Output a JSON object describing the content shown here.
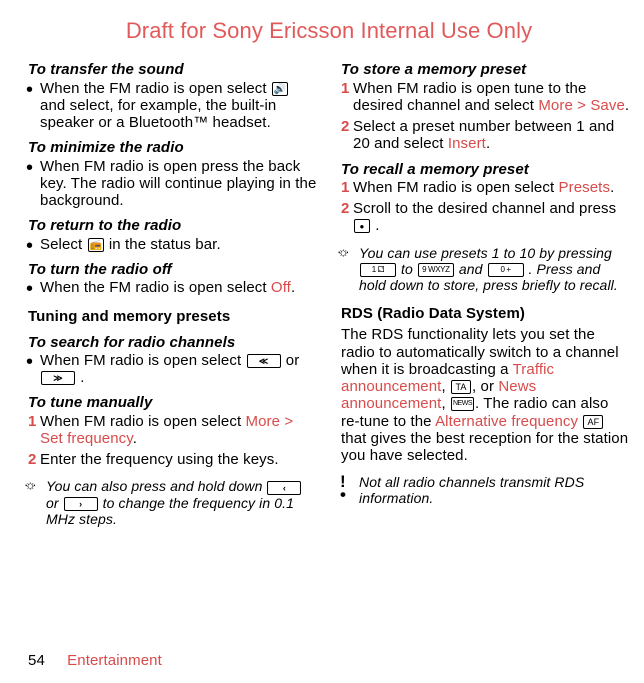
{
  "header": "Draft for Sony Ericsson Internal Use Only",
  "left": {
    "transfer": {
      "title": "To transfer the sound",
      "text_a": "When the FM radio is open select ",
      "text_b": " and select, for example, the built-in speaker or a Bluetooth™ headset."
    },
    "minimize": {
      "title": "To minimize the radio",
      "text": "When FM radio is open press the back key. The radio will continue playing in the background."
    },
    "return": {
      "title": "To return to the radio",
      "text_a": "Select ",
      "text_b": " in the status bar."
    },
    "off": {
      "title": "To turn the radio off",
      "text_a": "When the FM radio is open select ",
      "text_b": "Off",
      "text_c": "."
    },
    "tuning_header": "Tuning and memory presets",
    "search": {
      "title": "To search for radio channels",
      "text_a": "When FM radio is open select ",
      "text_or": " or ",
      "text_end": "."
    },
    "manual": {
      "title": "To tune manually",
      "l1_a": "When FM radio is open select ",
      "l1_b": "More",
      "l1_c": " > ",
      "l1_d": "Set frequency",
      "l1_e": ".",
      "l2": "Enter the frequency using the keys."
    },
    "note1_a": "You can also press and hold down ",
    "note1_or": " or ",
    "note1_b": " to change the frequency in 0.1 MHz steps."
  },
  "right": {
    "store": {
      "title": "To store a memory preset",
      "l1_a": "When FM radio is open tune to the desired channel and select ",
      "l1_b": "More",
      "l1_c": " > ",
      "l1_d": "Save",
      "l1_e": ".",
      "l2_a": "Select a preset number between 1 and 20 and select ",
      "l2_b": "Insert",
      "l2_c": "."
    },
    "recall": {
      "title": "To recall a memory preset",
      "l1_a": "When FM radio is open select ",
      "l1_b": "Presets",
      "l1_c": ".",
      "l2_a": "Scroll to the desired channel and press ",
      "l2_b": "."
    },
    "note_preset_a": "You can use presets 1 to 10 by pressing ",
    "note_preset_to": " to ",
    "note_preset_and": " and ",
    "note_preset_b": ". Press and hold down to store, press briefly to recall.",
    "key1": "1 ⚁",
    "key9": "9 WXYZ",
    "key0": "0 +",
    "rds": {
      "title": "RDS (Radio Data System)",
      "text_a": "The RDS functionality lets you set the radio to automatically switch to a channel when it is broadcasting a ",
      "traffic": "Traffic announcement",
      "text_b": ", ",
      "ta_label": "TA",
      "text_c": ", or ",
      "news": "News announcement",
      "text_d": ", ",
      "news_label": "NEWS",
      "text_e": ". The radio can also re-tune to the ",
      "alt": "Alternative frequency",
      "af_label": "AF",
      "text_f": " that gives the best reception for the station you have selected."
    },
    "note_rds": "Not all radio channels transmit RDS information."
  },
  "footer": {
    "page": "54",
    "section": "Entertainment"
  }
}
